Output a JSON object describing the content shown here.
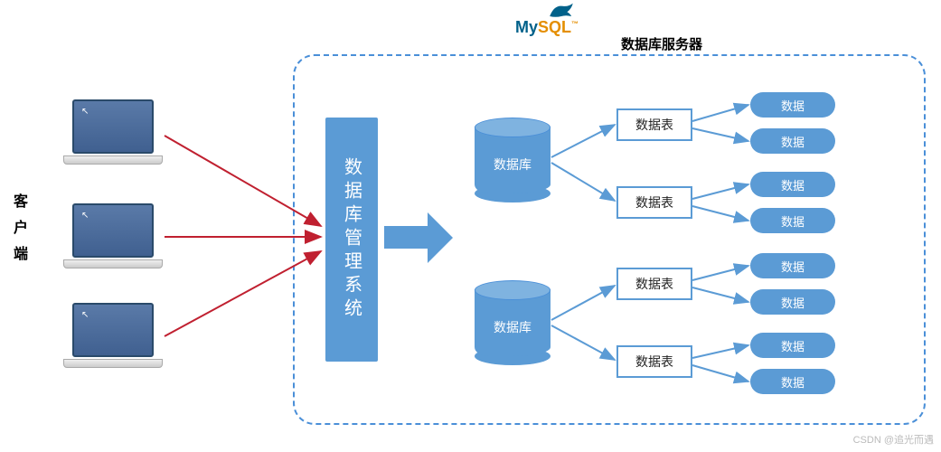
{
  "client_label": "客户端",
  "server_label": "数据库服务器",
  "mysql": {
    "my": "My",
    "sql": "SQL",
    "tm": "™"
  },
  "dbms_label": "数据库管理系统",
  "database_label": "数据库",
  "table_label": "数据表",
  "data_label": "数据",
  "watermark": "CSDN @追光而遇",
  "colors": {
    "primary": "#5b9bd5",
    "accent": "#4a8fd8",
    "mysql_blue": "#00618a",
    "mysql_orange": "#e48e00",
    "arrow_red": "#c02030"
  },
  "diagram": {
    "clients": 3,
    "databases": 2,
    "tables_per_database": 2,
    "data_per_table": 2,
    "flow": "clients → DBMS → databases → tables → data"
  }
}
